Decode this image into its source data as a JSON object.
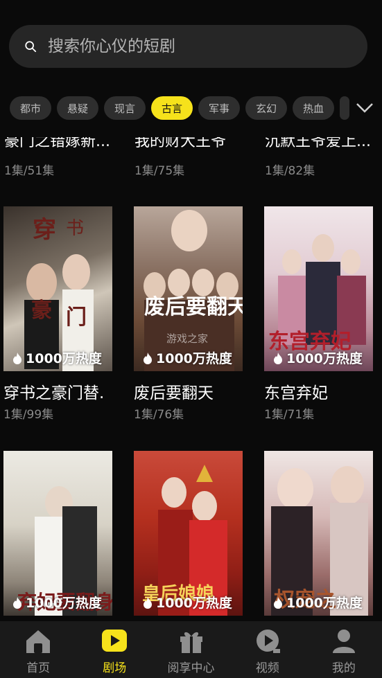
{
  "search": {
    "placeholder": "搜索你心仪的短剧"
  },
  "categories": [
    "都市",
    "悬疑",
    "现言",
    "古言",
    "军事",
    "玄幻",
    "热血"
  ],
  "active_category": "古言",
  "top_partial": [
    {
      "title": "豪门之错嫁新...",
      "eps": "1集/51集"
    },
    {
      "title": "我的财大王爷",
      "eps": "1集/75集"
    },
    {
      "title": "沉默王爷爱上...",
      "eps": "1集/82集"
    }
  ],
  "row1": [
    {
      "title": "穿书之豪门替.",
      "eps": "1集/99集",
      "heat": "1000万热度",
      "poster_text": "穿书之豪门替嫁"
    },
    {
      "title": "废后要翻天",
      "eps": "1集/76集",
      "heat": "1000万热度",
      "poster_text": "废后要翻天"
    },
    {
      "title": "东宫弃妃",
      "eps": "1集/71集",
      "heat": "1000万热度",
      "poster_text": "东宫弃妃"
    }
  ],
  "row2": [
    {
      "heat": "1000万热度",
      "poster_text": "弃妃要翻身"
    },
    {
      "heat": "1000万热度",
      "poster_text": "皇后娘娘"
    },
    {
      "heat": "1000万热度",
      "poster_text": "权宠之"
    }
  ],
  "watermark": "游戏之家",
  "tabs": [
    {
      "label": "首页",
      "icon": "home-icon"
    },
    {
      "label": "剧场",
      "icon": "theater-play-icon"
    },
    {
      "label": "阅享中心",
      "icon": "gift-icon"
    },
    {
      "label": "视频",
      "icon": "video-play-icon"
    },
    {
      "label": "我的",
      "icon": "person-icon"
    }
  ],
  "active_tab": "剧场",
  "colors": {
    "accent": "#f6e21b",
    "background": "#0a0a0a",
    "chip": "#2e2e2e",
    "tabbar": "#1a1a1a"
  }
}
